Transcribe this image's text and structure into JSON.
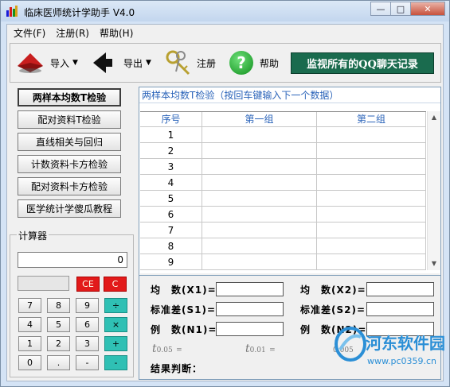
{
  "window": {
    "title": "临床医师统计学助手 V4.0",
    "controls": {
      "minimize": "—",
      "maximize": "□",
      "close": "✕"
    }
  },
  "menu": [
    "文件(F)",
    "注册(R)",
    "帮助(H)"
  ],
  "toolbar": {
    "import_label": "导入",
    "export_label": "导出",
    "register_label": "注册",
    "help_label": "帮助",
    "help_symbol": "?",
    "monitor_label": "监视所有的QQ聊天记录"
  },
  "left_buttons": [
    "两样本均数T检验",
    "配对资料T检验",
    "直线相关与回归",
    "计数资料卡方检验",
    "配对资料卡方检验",
    "医学统计学傻瓜教程"
  ],
  "calculator": {
    "label": "计算器",
    "display": "0",
    "keys": {
      "ce": "CE",
      "c": "C",
      "k7": "7",
      "k8": "8",
      "k9": "9",
      "div": "÷",
      "k4": "4",
      "k5": "5",
      "k6": "6",
      "mul": "×",
      "k1": "1",
      "k2": "2",
      "k3": "3",
      "add": "+",
      "k0": "0",
      "dot": ".",
      "sub": "-",
      "eq": "-"
    }
  },
  "panel": {
    "title": "两样本均数T检验（按回车键输入下一个数据）",
    "columns": [
      "序号",
      "第一组",
      "第二组"
    ],
    "rows": [
      "1",
      "2",
      "3",
      "4",
      "5",
      "6",
      "7",
      "8",
      "9"
    ]
  },
  "results": {
    "mean1": "均　数(X1)=",
    "mean2": "均　数(X2)=",
    "sd1": "标准差(S1)=",
    "sd2": "标准差(S2)=",
    "n1": "例　数(N1)=",
    "n2": "例　数(N2)=",
    "t05": "t",
    "t05_sub": "0.05",
    "t05_eq": "=",
    "t01": "t",
    "t01_sub": "0.01",
    "t01_eq": "=",
    "t005_sub": "0.005",
    "conclusion": "结果判断："
  },
  "watermark": {
    "brand": "河东软件园",
    "url": "www.pc0359.cn"
  },
  "colors": {
    "monitor_bg": "#1a6b4e",
    "calc_red": "#e21a1a",
    "calc_teal": "#2fc0b4",
    "header_text": "#2a63b9",
    "help_green": "#13a51f"
  }
}
